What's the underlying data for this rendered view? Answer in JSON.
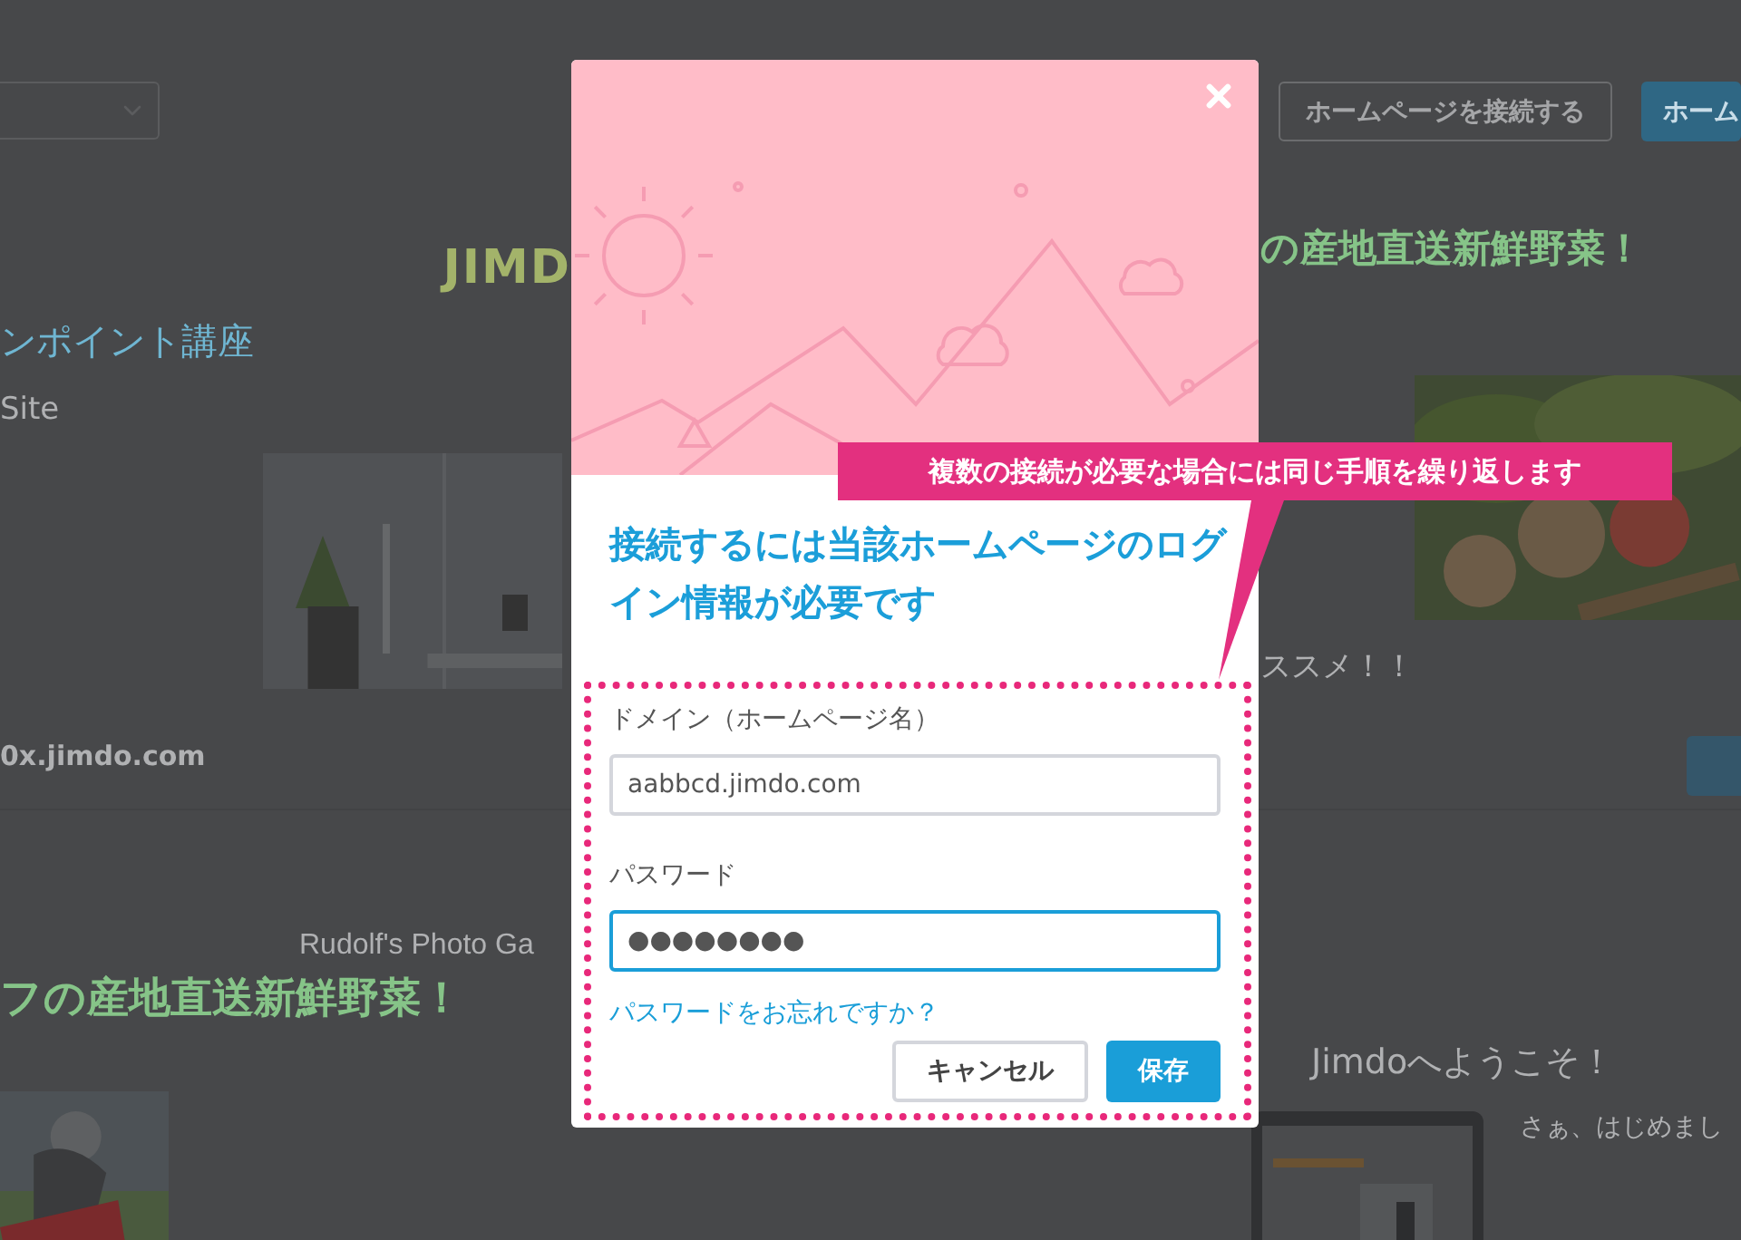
{
  "background_page": {
    "header_buttons": [
      {
        "label": "ホームページを接続する",
        "kind": "outline"
      },
      {
        "label": "ホーム",
        "kind": "primary"
      }
    ],
    "sites": [
      {
        "logo": "JIMD",
        "title": "ンポイント講座",
        "subtitle": "Site",
        "domain": "0x.jimdo.com"
      },
      {
        "title": "の産地直送新鮮野菜！",
        "section": "ススメ！！"
      },
      {
        "brand": "Rudolf's Photo Ga",
        "title": "フの産地直送新鮮野菜！"
      },
      {
        "title": "Jimdoへようこそ！",
        "subtitle": "さぁ、はじめまし"
      }
    ]
  },
  "dialog": {
    "title": "接続するには当該ホームページのログイン情報が必要です",
    "fields": [
      {
        "label": "ドメイン（ホームページ名）",
        "value": "aabbcd.jimdo.com",
        "focused": false
      },
      {
        "label": "パスワード",
        "value": "●●●●●●●●",
        "focused": true
      }
    ],
    "forgot_link": "パスワードをお忘れですか？",
    "buttons": [
      {
        "label": "キャンセル",
        "kind": "secondary"
      },
      {
        "label": "保存",
        "kind": "primary"
      }
    ]
  },
  "callout": "複数の接続が必要な場合には同じ手順を繰り返します"
}
